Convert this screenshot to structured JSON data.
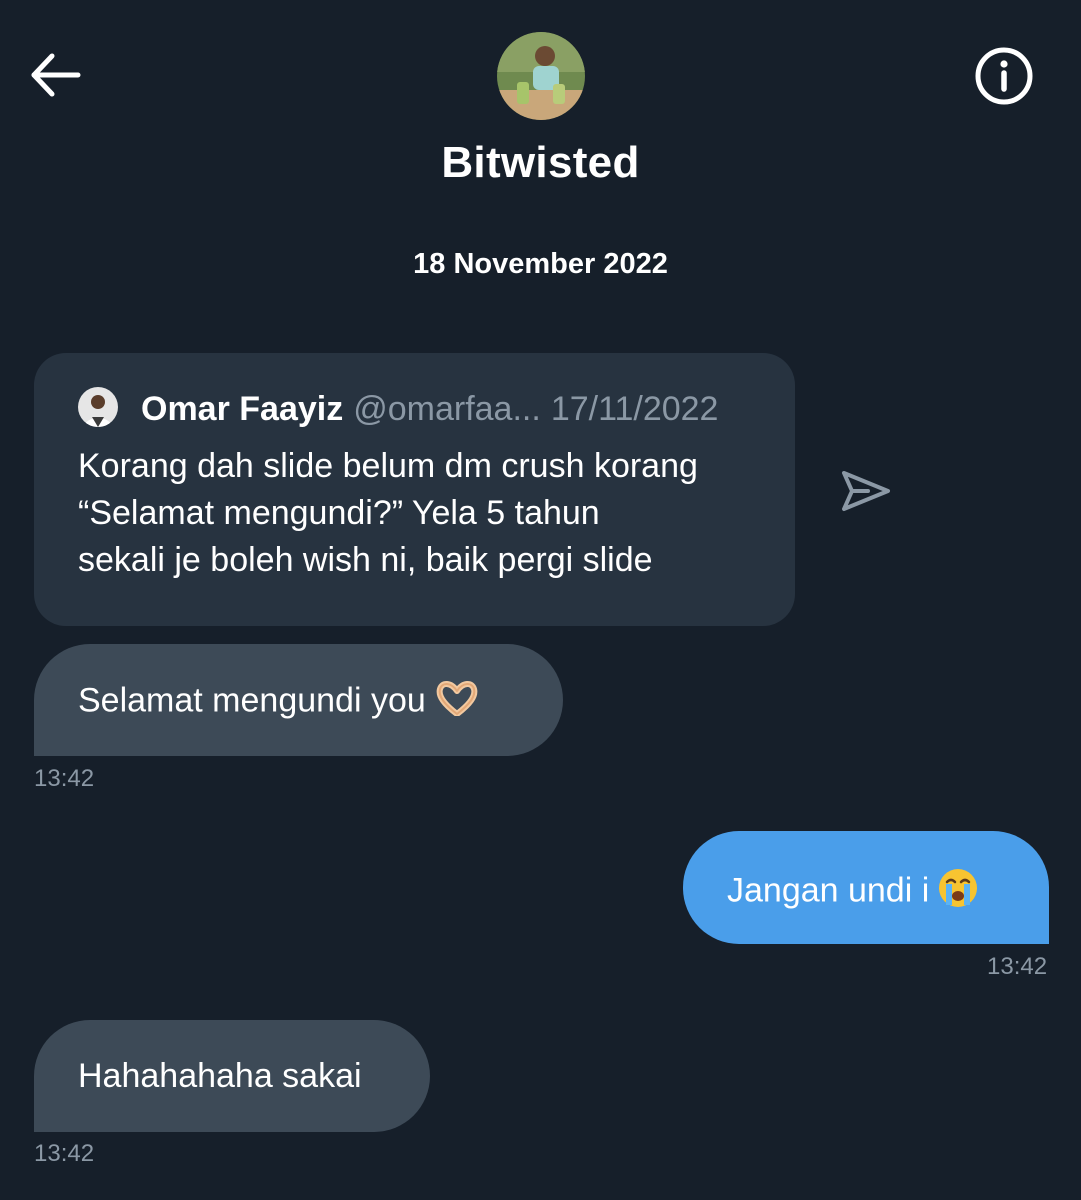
{
  "header": {
    "contact_name": "Bitwisted",
    "icons": {
      "back": "arrow-left-icon",
      "info": "info-circle-icon"
    }
  },
  "date_separator": "18 November 2022",
  "quoted_tweet": {
    "author_name": "Omar Faayiz",
    "author_handle": "@omarfaa...",
    "date": "17/11/2022",
    "text_lines": [
      "Korang dah slide belum dm crush korang",
      "“Selamat mengundi?” Yela 5 tahun",
      "sekali je boleh wish ni, baik pergi slide"
    ],
    "share_icon": "send-icon"
  },
  "messages": [
    {
      "direction": "received",
      "text": "Selamat mengundi you",
      "emoji": "heart-hands-emoji",
      "time": "13:42"
    },
    {
      "direction": "sent",
      "text": "Jangan undi i",
      "emoji": "loudly-crying-face-emoji",
      "time": "13:42"
    },
    {
      "direction": "received",
      "text": "Hahahahaha sakai",
      "time": "13:42"
    }
  ],
  "colors": {
    "background": "#161f2a",
    "quote_card": "#273340",
    "received_bubble": "#3d4a57",
    "sent_bubble": "#4a9eea",
    "muted_text": "#8b98a5"
  }
}
